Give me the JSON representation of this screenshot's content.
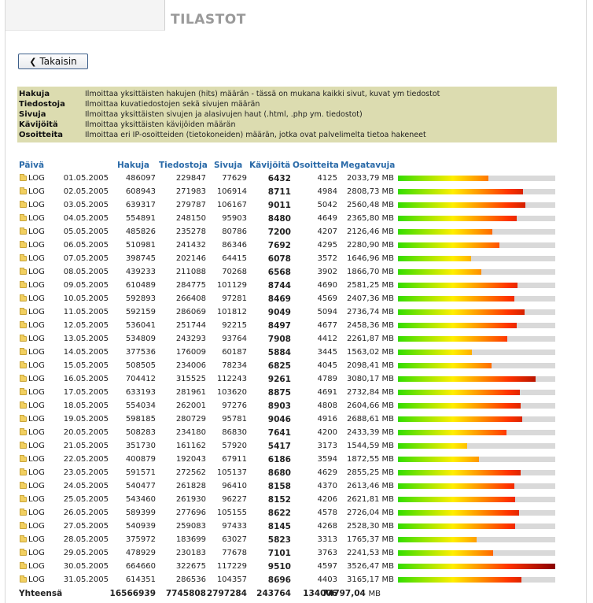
{
  "page": {
    "title": "TILASTOT"
  },
  "nav": {
    "back_label": "Takaisin"
  },
  "legend": [
    {
      "term": "Hakuja",
      "desc": "Ilmoittaa yksittäisten hakujen (hits) määrän - tässä on mukana kaikki sivut, kuvat ym tiedostot"
    },
    {
      "term": "Tiedostoja",
      "desc": "Ilmoittaa kuvatiedostojen sekä sivujen määrän"
    },
    {
      "term": "Sivuja",
      "desc": "Ilmoittaa yksittäisten sivujen ja alasivujen haut (.html, .php ym. tiedostot)"
    },
    {
      "term": "Kävijöitä",
      "desc": "Ilmoittaa yksittäisten kävijöiden määrän"
    },
    {
      "term": "Osoitteita",
      "desc": "Ilmoittaa eri IP-osoitteiden (tietokoneiden) määrän, jotka ovat palvelimelta tietoa hakeneet"
    }
  ],
  "table": {
    "headers": {
      "date": "Päivä",
      "hits": "Hakuja",
      "files": "Tiedostoja",
      "pages": "Sivuja",
      "visitors": "Kävijöitä",
      "addresses": "Osoitteita",
      "megabytes": "Megatavuja"
    },
    "log_label": "LOG",
    "bar_max_mb": 3530,
    "rows": [
      {
        "date": "01.05.2005",
        "hits": "486097",
        "files": "229847",
        "pages": "77629",
        "visitors": "6432",
        "addresses": "4125",
        "mb": "2033,79 MB",
        "mb_value": 2033.79
      },
      {
        "date": "02.05.2005",
        "hits": "608943",
        "files": "271983",
        "pages": "106914",
        "visitors": "8711",
        "addresses": "4984",
        "mb": "2808,73 MB",
        "mb_value": 2808.73
      },
      {
        "date": "03.05.2005",
        "hits": "639317",
        "files": "279787",
        "pages": "106167",
        "visitors": "9011",
        "addresses": "5042",
        "mb": "2560,48 MB",
        "mb_value": 2860.48
      },
      {
        "date": "04.05.2005",
        "hits": "554891",
        "files": "248150",
        "pages": "95903",
        "visitors": "8480",
        "addresses": "4649",
        "mb": "2365,80 MB",
        "mb_value": 2665.8
      },
      {
        "date": "05.05.2005",
        "hits": "485826",
        "files": "235278",
        "pages": "80786",
        "visitors": "7200",
        "addresses": "4207",
        "mb": "2126,46 MB",
        "mb_value": 2126.46
      },
      {
        "date": "06.05.2005",
        "hits": "510981",
        "files": "241432",
        "pages": "86346",
        "visitors": "7692",
        "addresses": "4295",
        "mb": "2280,90 MB",
        "mb_value": 2280.9
      },
      {
        "date": "07.05.2005",
        "hits": "398745",
        "files": "202146",
        "pages": "64415",
        "visitors": "6078",
        "addresses": "3572",
        "mb": "1646,96 MB",
        "mb_value": 1646.96
      },
      {
        "date": "08.05.2005",
        "hits": "439233",
        "files": "211088",
        "pages": "70268",
        "visitors": "6568",
        "addresses": "3902",
        "mb": "1866,70 MB",
        "mb_value": 1866.7
      },
      {
        "date": "09.05.2005",
        "hits": "610489",
        "files": "284775",
        "pages": "101129",
        "visitors": "8744",
        "addresses": "4690",
        "mb": "2581,25 MB",
        "mb_value": 2681.25
      },
      {
        "date": "10.05.2005",
        "hits": "592893",
        "files": "266408",
        "pages": "97281",
        "visitors": "8469",
        "addresses": "4569",
        "mb": "2407,36 MB",
        "mb_value": 2607.36
      },
      {
        "date": "11.05.2005",
        "hits": "592159",
        "files": "286069",
        "pages": "101812",
        "visitors": "9049",
        "addresses": "5094",
        "mb": "2736,74 MB",
        "mb_value": 2836.74
      },
      {
        "date": "12.05.2005",
        "hits": "536041",
        "files": "251744",
        "pages": "92215",
        "visitors": "8497",
        "addresses": "4677",
        "mb": "2458,36 MB",
        "mb_value": 2658.36
      },
      {
        "date": "13.05.2005",
        "hits": "534809",
        "files": "243293",
        "pages": "93764",
        "visitors": "7908",
        "addresses": "4412",
        "mb": "2261,87 MB",
        "mb_value": 2461.87
      },
      {
        "date": "14.05.2005",
        "hits": "377536",
        "files": "176009",
        "pages": "60187",
        "visitors": "5884",
        "addresses": "3445",
        "mb": "1563,02 MB",
        "mb_value": 1663.02
      },
      {
        "date": "15.05.2005",
        "hits": "508505",
        "files": "234006",
        "pages": "78234",
        "visitors": "6825",
        "addresses": "4045",
        "mb": "2098,41 MB",
        "mb_value": 2098.41
      },
      {
        "date": "16.05.2005",
        "hits": "704412",
        "files": "315525",
        "pages": "112243",
        "visitors": "9261",
        "addresses": "4789",
        "mb": "3080,17 MB",
        "mb_value": 3080.17
      },
      {
        "date": "17.05.2005",
        "hits": "633193",
        "files": "281961",
        "pages": "103620",
        "visitors": "8875",
        "addresses": "4691",
        "mb": "2732,84 MB",
        "mb_value": 2732.84
      },
      {
        "date": "18.05.2005",
        "hits": "554034",
        "files": "262001",
        "pages": "97276",
        "visitors": "8903",
        "addresses": "4808",
        "mb": "2604,66 MB",
        "mb_value": 2754.66
      },
      {
        "date": "19.05.2005",
        "hits": "598185",
        "files": "280729",
        "pages": "95781",
        "visitors": "9046",
        "addresses": "4916",
        "mb": "2688,61 MB",
        "mb_value": 2788.61
      },
      {
        "date": "20.05.2005",
        "hits": "508283",
        "files": "234180",
        "pages": "86830",
        "visitors": "7641",
        "addresses": "4200",
        "mb": "2433,39 MB",
        "mb_value": 2433.39
      },
      {
        "date": "21.05.2005",
        "hits": "351730",
        "files": "161162",
        "pages": "57920",
        "visitors": "5417",
        "addresses": "3173",
        "mb": "1544,59 MB",
        "mb_value": 1544.59
      },
      {
        "date": "22.05.2005",
        "hits": "400879",
        "files": "192043",
        "pages": "67911",
        "visitors": "6186",
        "addresses": "3594",
        "mb": "1872,55 MB",
        "mb_value": 1822.55
      },
      {
        "date": "23.05.2005",
        "hits": "591571",
        "files": "272562",
        "pages": "105137",
        "visitors": "8680",
        "addresses": "4629",
        "mb": "2855,25 MB",
        "mb_value": 2755.25
      },
      {
        "date": "24.05.2005",
        "hits": "540477",
        "files": "261828",
        "pages": "96410",
        "visitors": "8158",
        "addresses": "4370",
        "mb": "2613,46 MB",
        "mb_value": 2613.46
      },
      {
        "date": "25.05.2005",
        "hits": "543460",
        "files": "261930",
        "pages": "96227",
        "visitors": "8152",
        "addresses": "4206",
        "mb": "2621,81 MB",
        "mb_value": 2621.81
      },
      {
        "date": "26.05.2005",
        "hits": "589399",
        "files": "277696",
        "pages": "105155",
        "visitors": "8622",
        "addresses": "4578",
        "mb": "2726,04 MB",
        "mb_value": 2726.04
      },
      {
        "date": "27.05.2005",
        "hits": "540939",
        "files": "259083",
        "pages": "97433",
        "visitors": "8145",
        "addresses": "4268",
        "mb": "2528,30 MB",
        "mb_value": 2628.3
      },
      {
        "date": "28.05.2005",
        "hits": "375972",
        "files": "183699",
        "pages": "63027",
        "visitors": "5823",
        "addresses": "3313",
        "mb": "1765,37 MB",
        "mb_value": 1765.37
      },
      {
        "date": "29.05.2005",
        "hits": "478929",
        "files": "230183",
        "pages": "77678",
        "visitors": "7101",
        "addresses": "3763",
        "mb": "2241,53 MB",
        "mb_value": 2141.53
      },
      {
        "date": "30.05.2005",
        "hits": "664660",
        "files": "322675",
        "pages": "117229",
        "visitors": "9510",
        "addresses": "4597",
        "mb": "3526,47 MB",
        "mb_value": 3526.47
      },
      {
        "date": "31.05.2005",
        "hits": "614351",
        "files": "286536",
        "pages": "104357",
        "visitors": "8696",
        "addresses": "4403",
        "mb": "3165,17 MB",
        "mb_value": 2765.17
      }
    ],
    "totals": {
      "label": "Yhteensä",
      "hits": "16566939",
      "files": "7745808",
      "pages": "2797284",
      "visitors": "243764",
      "addresses": "134006",
      "mb_num": "74797,04",
      "mb_unit": "MB"
    }
  }
}
